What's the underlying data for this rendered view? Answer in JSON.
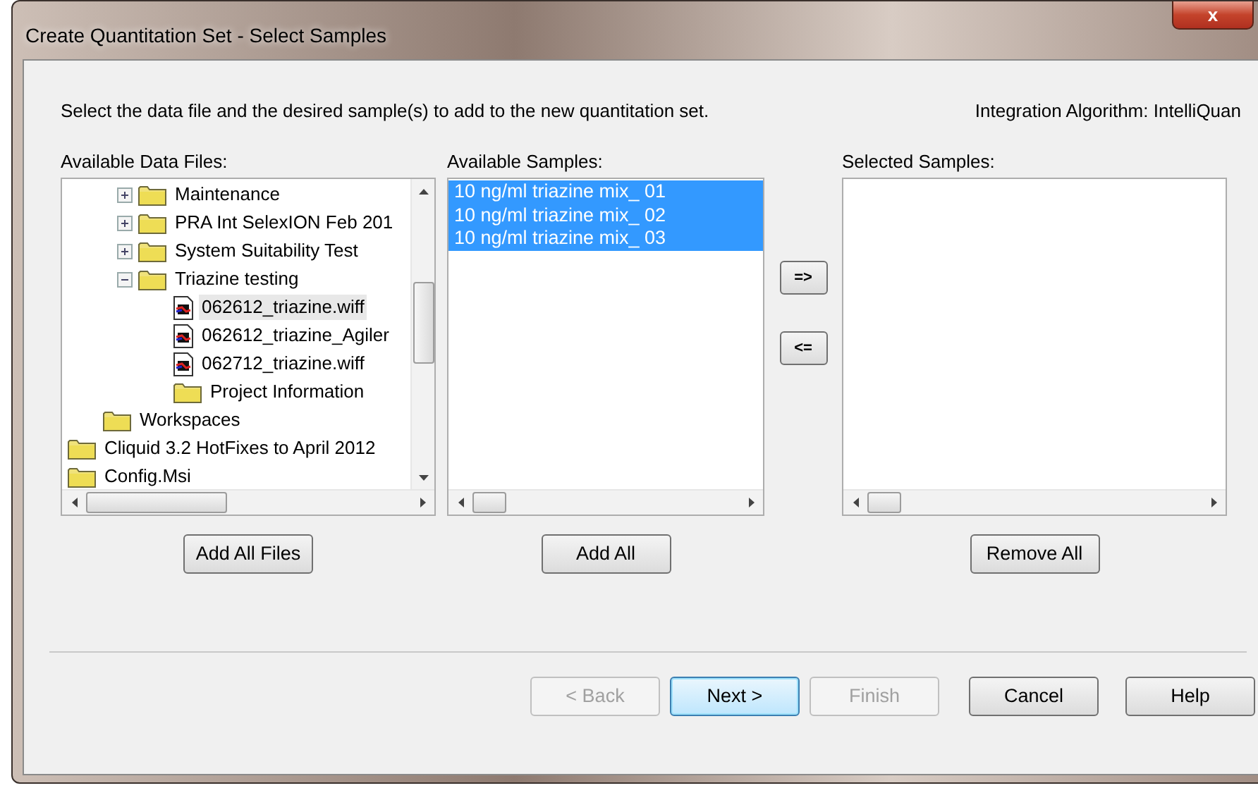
{
  "window": {
    "title": "Create Quantitation Set - Select Samples",
    "close": "x"
  },
  "instruction": "Select the data file and the desired sample(s) to add to the new quantitation set.",
  "algorithm": "Integration Algorithm: IntelliQuan",
  "files": {
    "label": "Available Data Files:",
    "items": [
      {
        "children": [
          {
            "children": [
              {
                "label": "Maintenance",
                "kind": "folder",
                "expanded": false,
                "selected": false
              },
              {
                "label": "PRA Int SelexION Feb 201",
                "kind": "folder",
                "expanded": false,
                "selected": false
              },
              {
                "label": "System Suitability Test",
                "kind": "folder",
                "expanded": false,
                "selected": false
              },
              {
                "label": "Triazine testing",
                "kind": "folder",
                "expanded": true,
                "selected": false,
                "children": [
                  {
                    "label": "062612_triazine.wiff",
                    "kind": "file",
                    "selected": true
                  },
                  {
                    "label": "062612_triazine_Agiler",
                    "kind": "file",
                    "selected": false
                  },
                  {
                    "label": "062712_triazine.wiff",
                    "kind": "file",
                    "selected": false
                  },
                  {
                    "label": "Project Information",
                    "kind": "folder",
                    "selected": false
                  }
                ]
              }
            ]
          },
          {
            "label": "Workspaces",
            "kind": "folder",
            "selected": false
          }
        ]
      },
      {
        "label": "Cliquid 3.2 HotFixes to April 2012",
        "kind": "folder",
        "selected": false
      },
      {
        "label": "Config.Msi",
        "kind": "folder",
        "selected": false
      }
    ],
    "button": "Add All Files"
  },
  "available": {
    "label": "Available Samples:",
    "items": [
      {
        "label": "10 ng/ml triazine mix_ 01",
        "selected": true
      },
      {
        "label": "10 ng/ml triazine mix_ 02",
        "selected": true
      },
      {
        "label": "10 ng/ml triazine mix_ 03",
        "selected": true
      }
    ],
    "button": "Add All"
  },
  "move_buttons": [
    "=>",
    "<="
  ],
  "selected": {
    "label": "Selected Samples:",
    "button": "Remove All"
  },
  "footer_buttons": [
    {
      "label": "< Back",
      "disabled": true,
      "default": false
    },
    {
      "label": "Next >",
      "disabled": false,
      "default": true
    },
    {
      "label": "Finish",
      "disabled": true,
      "default": false
    },
    {
      "label": "Cancel",
      "disabled": false,
      "default": false
    },
    {
      "label": "Help",
      "disabled": false,
      "default": false
    }
  ]
}
